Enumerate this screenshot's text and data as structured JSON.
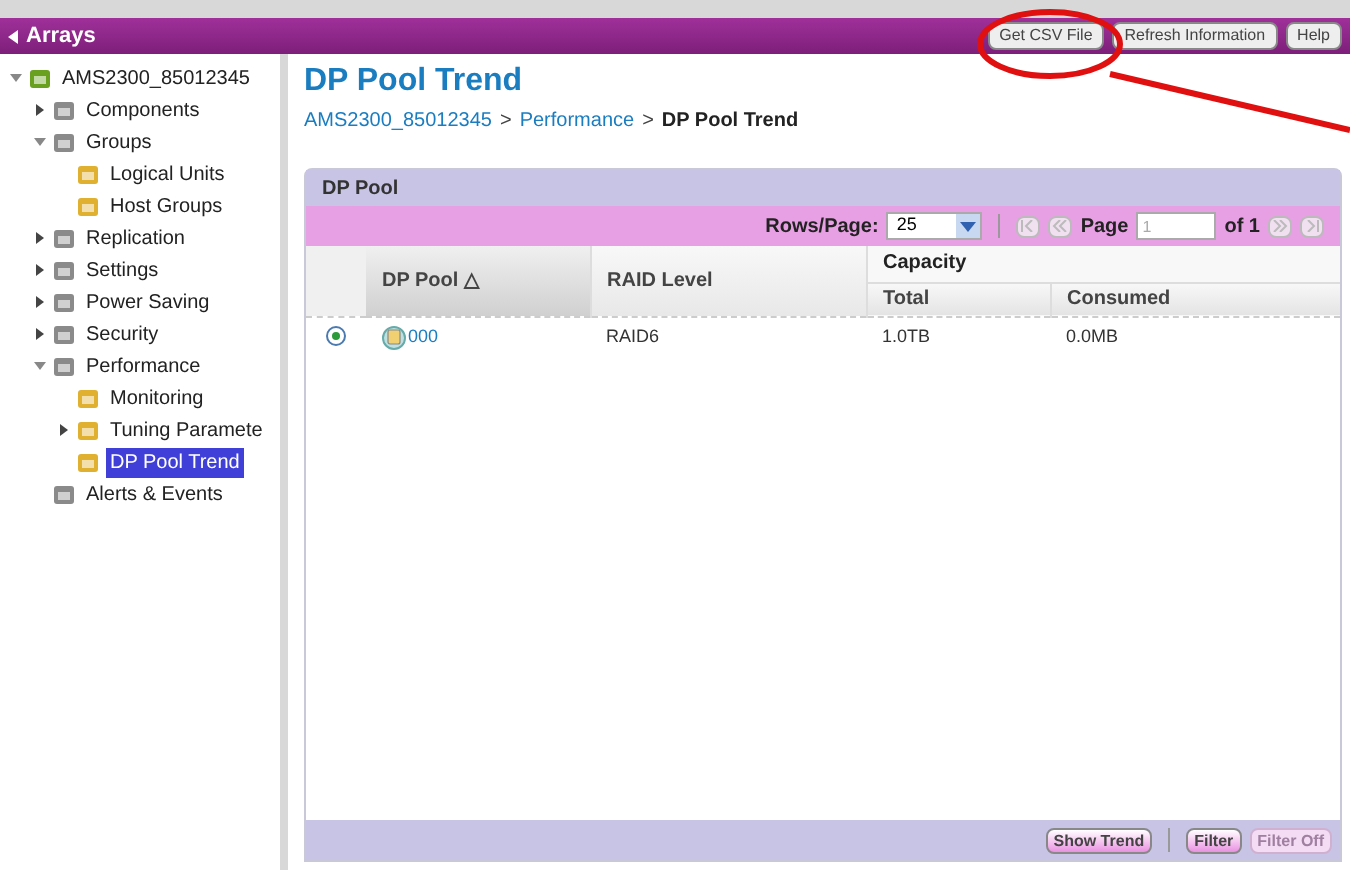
{
  "header": {
    "title": "Arrays",
    "buttons": [
      {
        "label": "Get CSV File",
        "disabled": false
      },
      {
        "label": "Refresh Information",
        "disabled": false
      },
      {
        "label": "Help",
        "disabled": false
      }
    ]
  },
  "sidebar": {
    "items": [
      {
        "label": "AMS2300_85012345",
        "expanded": true,
        "selected": false,
        "children": [
          {
            "label": "Components",
            "expanded": false,
            "selected": false
          },
          {
            "label": "Groups",
            "expanded": true,
            "selected": false,
            "children": [
              {
                "label": "Logical Units",
                "selected": false
              },
              {
                "label": "Host Groups",
                "selected": false
              }
            ]
          },
          {
            "label": "Replication",
            "expanded": false,
            "selected": false
          },
          {
            "label": "Settings",
            "expanded": false,
            "selected": false
          },
          {
            "label": "Power Saving",
            "expanded": false,
            "selected": false
          },
          {
            "label": "Security",
            "expanded": false,
            "selected": false
          },
          {
            "label": "Performance",
            "expanded": true,
            "selected": false,
            "children": [
              {
                "label": "Monitoring",
                "selected": false
              },
              {
                "label": "Tuning Paramete",
                "expanded": false,
                "selected": false
              },
              {
                "label": "DP Pool Trend",
                "selected": true
              }
            ]
          },
          {
            "label": "Alerts & Events",
            "selected": false
          }
        ]
      }
    ]
  },
  "page": {
    "title": "DP Pool Trend",
    "breadcrumb": [
      "AMS2300_85012345",
      "Performance",
      "DP Pool Trend"
    ],
    "separator": ">"
  },
  "panel": {
    "title": "DP Pool",
    "rows_per_page_label": "Rows/Page:",
    "rows_per_page": "25",
    "page_label": "Page",
    "page_value": "1",
    "page_total": "of 1",
    "columns": [
      {
        "label": "DP Pool",
        "sort": "△"
      },
      {
        "label": "RAID Level"
      },
      {
        "label": "Capacity",
        "colspan": 2,
        "children": [
          "Total",
          "Consumed"
        ]
      }
    ],
    "rows": [
      {
        "selected": true,
        "cells": [
          "000",
          "RAID6",
          "1.0TB",
          "0.0MB"
        ]
      }
    ],
    "buttons": [
      {
        "label": "Show Trend",
        "disabled": false
      },
      {
        "label": "Filter",
        "disabled": false
      },
      {
        "label": "Filter Off",
        "disabled": true
      }
    ]
  }
}
